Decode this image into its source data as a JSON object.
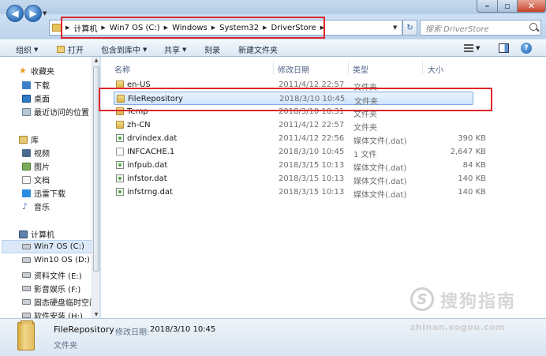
{
  "address_bar": {
    "crumbs": [
      "计算机",
      "Win7 OS (C:)",
      "Windows",
      "System32",
      "DriverStore"
    ],
    "refresh_symbol": "↻",
    "search_placeholder": "搜索 DriverStore"
  },
  "toolbar": {
    "organize": "组织",
    "open": "打开",
    "include_in_library": "包含到库中",
    "share": "共享",
    "burn": "刻录",
    "new_folder": "新建文件夹"
  },
  "nav": {
    "favorites": "收藏夹",
    "downloads": "下载",
    "desktop": "桌面",
    "recent": "最近访问的位置",
    "libraries": "库",
    "videos": "视频",
    "pictures": "图片",
    "documents": "文档",
    "xunlei": "迅雷下载",
    "music": "音乐",
    "computer": "计算机",
    "drive_c": "Win7 OS (C:)",
    "drive_d": "Win10 OS (D:)",
    "drive_e": "资料文件 (E:)",
    "drive_f": "影音娱乐 (F:)",
    "drive_g": "固态硬盘临时空间",
    "drive_h": "软件安装 (H:)"
  },
  "columns": {
    "name": "名称",
    "modified": "修改日期",
    "type": "类型",
    "size": "大小"
  },
  "files": [
    {
      "name": "en-US",
      "modified": "2011/4/12 22:57",
      "type": "文件夹",
      "size": "",
      "icon": "folder-icon"
    },
    {
      "name": "FileRepository",
      "modified": "2018/3/10 10:45",
      "type": "文件夹",
      "size": "",
      "icon": "folder-icon"
    },
    {
      "name": "Temp",
      "modified": "2018/3/10 10:31",
      "type": "文件夹",
      "size": "",
      "icon": "folder-icon"
    },
    {
      "name": "zh-CN",
      "modified": "2011/4/12 22:57",
      "type": "文件夹",
      "size": "",
      "icon": "folder-icon"
    },
    {
      "name": "drvindex.dat",
      "modified": "2011/4/12 22:56",
      "type": "媒体文件(.dat)",
      "size": "390 KB",
      "icon": "media-file-icon"
    },
    {
      "name": "INFCACHE.1",
      "modified": "2018/3/10 10:45",
      "type": "1 文件",
      "size": "2,647 KB",
      "icon": "file-icon"
    },
    {
      "name": "infpub.dat",
      "modified": "2018/3/15 10:13",
      "type": "媒体文件(.dat)",
      "size": "84 KB",
      "icon": "media-file-icon"
    },
    {
      "name": "infstor.dat",
      "modified": "2018/3/15 10:13",
      "type": "媒体文件(.dat)",
      "size": "140 KB",
      "icon": "media-file-icon"
    },
    {
      "name": "infstrng.dat",
      "modified": "2018/3/15 10:13",
      "type": "媒体文件(.dat)",
      "size": "140 KB",
      "icon": "media-file-icon"
    }
  ],
  "details": {
    "name": "FileRepository",
    "modified_label": "修改日期:",
    "modified_value": "2018/3/10 10:45",
    "type": "文件夹"
  },
  "watermark": {
    "logo_letter": "S",
    "text": "搜狗指南",
    "url": "zhinan.sogou.com"
  }
}
